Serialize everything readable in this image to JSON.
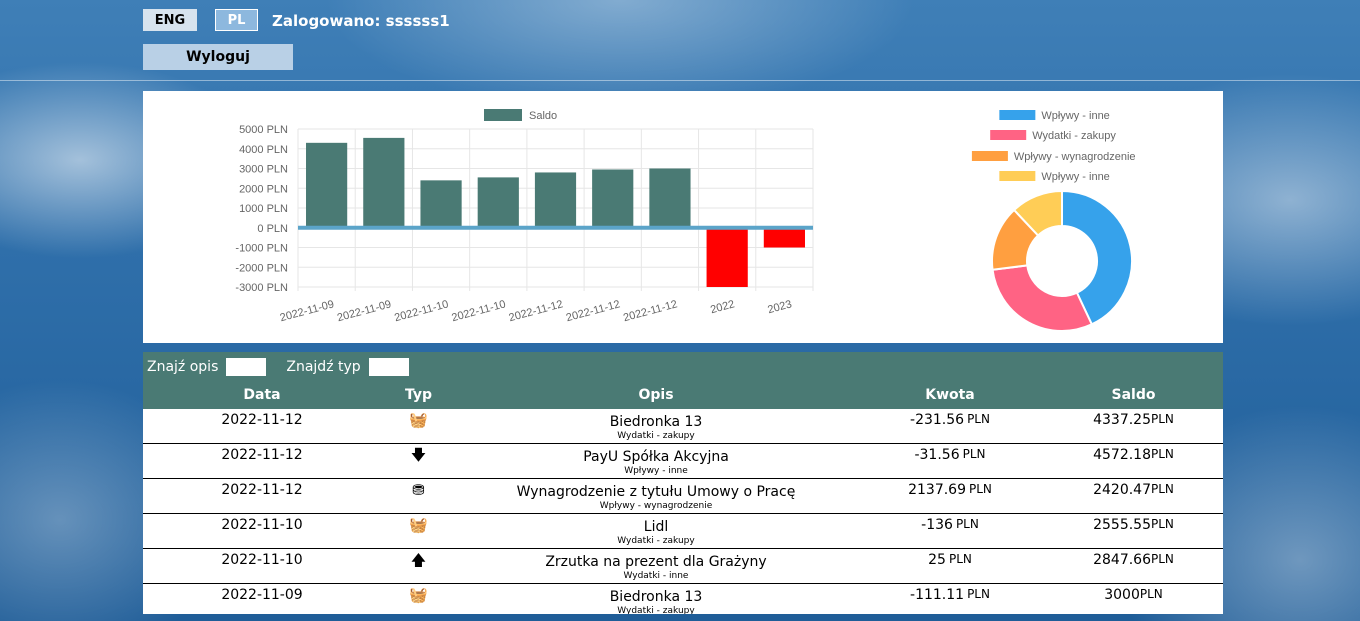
{
  "header": {
    "lang_eng": "ENG",
    "lang_pl": "PL",
    "logged_in_label": "Zalogowano: ssssss1",
    "logout_label": "Wyloguj"
  },
  "colors": {
    "bar_positive": "#4a7a74",
    "bar_negative": "#ff0000",
    "zero_line": "#5ba4c9",
    "header_bg": "#4a7a74"
  },
  "chart_data": [
    {
      "type": "bar",
      "legend": [
        "Saldo"
      ],
      "legend_position": "top",
      "categories": [
        "2022-11-09",
        "2022-11-09",
        "2022-11-10",
        "2022-11-10",
        "2022-11-12",
        "2022-11-12",
        "2022-11-12",
        "2022",
        "2023"
      ],
      "series": [
        {
          "name": "Saldo",
          "values": [
            4300,
            4550,
            2400,
            2550,
            2800,
            2950,
            3000,
            -3000,
            -1000
          ]
        }
      ],
      "yticks": [
        "5000 PLN",
        "4000 PLN",
        "3000 PLN",
        "2000 PLN",
        "1000 PLN",
        "0 PLN",
        "-1000 PLN",
        "-2000 PLN",
        "-3000 PLN"
      ],
      "ylim": [
        -3000,
        5000
      ],
      "grid": true
    },
    {
      "type": "pie",
      "legend_position": "top",
      "labels": [
        "Wpływy - inne",
        "Wydatki - zakupy",
        "Wpływy - wynagrodzenie",
        "Wpływy - inne"
      ],
      "colors": [
        "#36a2eb",
        "#ff6384",
        "#ff9f40",
        "#ffcd56"
      ],
      "values": [
        43,
        30,
        15,
        12
      ]
    }
  ],
  "filters": {
    "desc_label": "Znajź opis",
    "type_label": "Znajdź typ"
  },
  "table": {
    "columns": [
      "Data",
      "Typ",
      "Opis",
      "Kwota",
      "Saldo"
    ],
    "currency": "PLN",
    "rows": [
      {
        "date": "2022-11-12",
        "icon": "basket-icon",
        "glyph": "🧺",
        "desc": "Biedronka 13",
        "category": "Wydatki - zakupy",
        "amount": "-231.56",
        "balance": "4337.25"
      },
      {
        "date": "2022-11-12",
        "icon": "arrow-down-icon",
        "glyph": "🡇",
        "desc": "PayU Spółka Akcyjna",
        "category": "Wpływy - inne",
        "amount": "-31.56",
        "balance": "4572.18"
      },
      {
        "date": "2022-11-12",
        "icon": "coins-icon",
        "glyph": "⛃",
        "desc": "Wynagrodzenie z tytułu Umowy o Pracę",
        "category": "Wpływy - wynagrodzenie",
        "amount": "2137.69",
        "balance": "2420.47"
      },
      {
        "date": "2022-11-10",
        "icon": "basket-icon",
        "glyph": "🧺",
        "desc": "Lidl",
        "category": "Wydatki - zakupy",
        "amount": "-136",
        "balance": "2555.55"
      },
      {
        "date": "2022-11-10",
        "icon": "arrow-up-icon",
        "glyph": "🡅",
        "desc": "Zrzutka na prezent dla Grażyny",
        "category": "Wydatki - inne",
        "amount": "25",
        "balance": "2847.66"
      },
      {
        "date": "2022-11-09",
        "icon": "basket-icon",
        "glyph": "🧺",
        "desc": "Biedronka 13",
        "category": "Wydatki - zakupy",
        "amount": "-111.11",
        "balance": "3000"
      }
    ]
  }
}
